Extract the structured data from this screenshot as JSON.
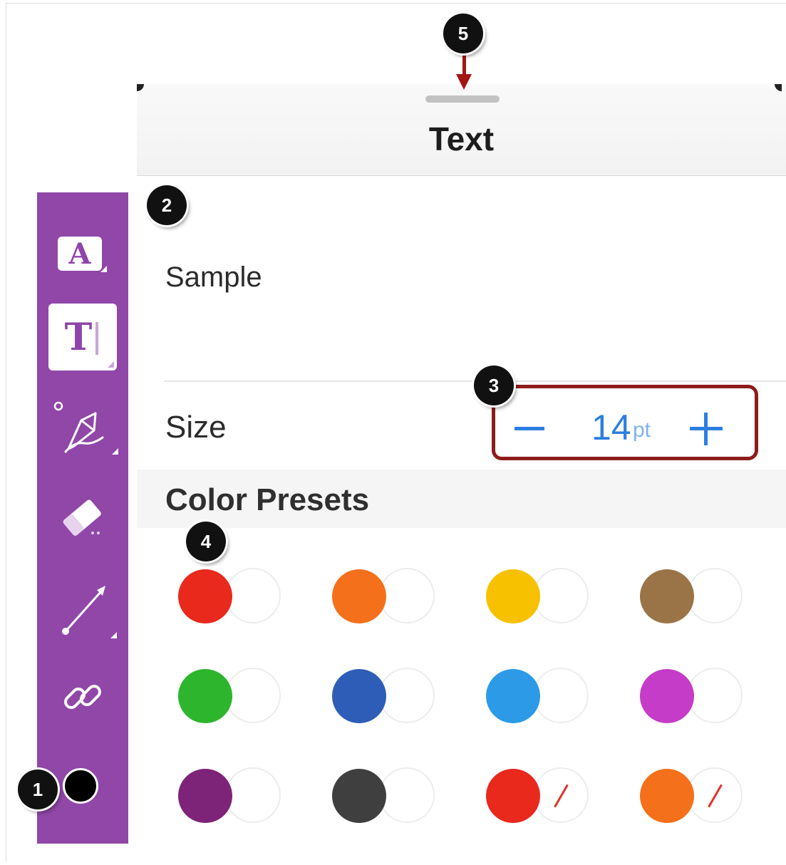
{
  "panel": {
    "title": "Text",
    "sample": "Sample",
    "size": {
      "label": "Size",
      "value": "14",
      "unit": "pt",
      "decrement_icon": "minus-icon",
      "increment_icon": "plus-icon"
    },
    "color_presets": {
      "label": "Color Presets",
      "swatches": [
        {
          "color": "#e8291c",
          "background": "none"
        },
        {
          "color": "#f4701a",
          "background": "none"
        },
        {
          "color": "#f7c100",
          "background": "none"
        },
        {
          "color": "#9a7446",
          "background": "none"
        },
        {
          "color": "#2db52d",
          "background": "none"
        },
        {
          "color": "#2d5db7",
          "background": "none"
        },
        {
          "color": "#2d9ae8",
          "background": "none"
        },
        {
          "color": "#c43cc7",
          "background": "none"
        },
        {
          "color": "#7e2478",
          "background": "none"
        },
        {
          "color": "#3f3f3f",
          "background": "none"
        },
        {
          "color": "#e8291c",
          "background": "transparent-slash"
        },
        {
          "color": "#f4701a",
          "background": "transparent-slash"
        }
      ]
    }
  },
  "toolbar": {
    "background_color": "#9047a8",
    "tools": [
      {
        "name": "text-style",
        "icon": "a-letter-icon",
        "glyph": "A"
      },
      {
        "name": "text-insert",
        "icon": "t-cursor-icon",
        "glyph": "T",
        "selected": true
      },
      {
        "name": "pen",
        "icon": "pen-icon"
      },
      {
        "name": "eraser",
        "icon": "eraser-icon"
      },
      {
        "name": "line",
        "icon": "line-arrow-icon"
      },
      {
        "name": "link",
        "icon": "link-icon"
      }
    ],
    "current_color": "#000000"
  },
  "annotations": {
    "callouts": [
      "1",
      "2",
      "3",
      "4",
      "5"
    ],
    "highlight_color": "#8e1c1c"
  }
}
